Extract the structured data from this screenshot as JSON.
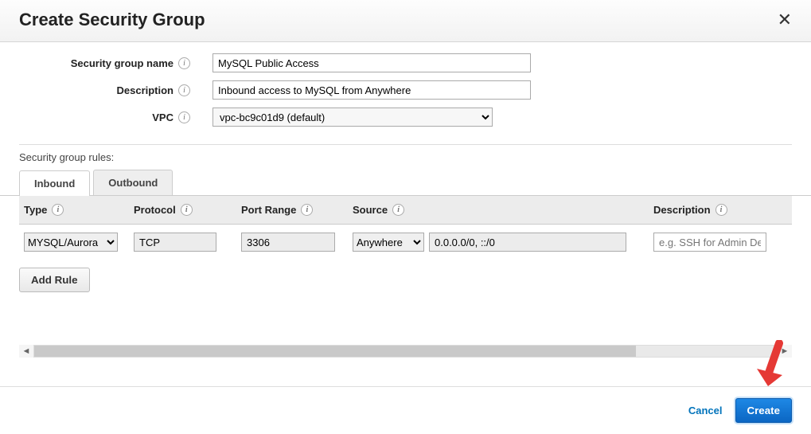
{
  "modal": {
    "title": "Create Security Group"
  },
  "form": {
    "name_label": "Security group name",
    "name_value": "MySQL Public Access",
    "desc_label": "Description",
    "desc_value": "Inbound access to MySQL from Anywhere",
    "vpc_label": "VPC",
    "vpc_value": "vpc-bc9c01d9 (default)"
  },
  "rules_label": "Security group rules:",
  "tabs": {
    "inbound": "Inbound",
    "outbound": "Outbound"
  },
  "headers": {
    "type": "Type",
    "protocol": "Protocol",
    "port": "Port Range",
    "source": "Source",
    "description": "Description"
  },
  "row": {
    "type": "MYSQL/Aurora",
    "protocol": "TCP",
    "port": "3306",
    "source_mode": "Anywhere",
    "source_value": "0.0.0.0/0, ::/0",
    "desc_placeholder": "e.g. SSH for Admin Desktop"
  },
  "buttons": {
    "add_rule": "Add Rule",
    "cancel": "Cancel",
    "create": "Create"
  }
}
